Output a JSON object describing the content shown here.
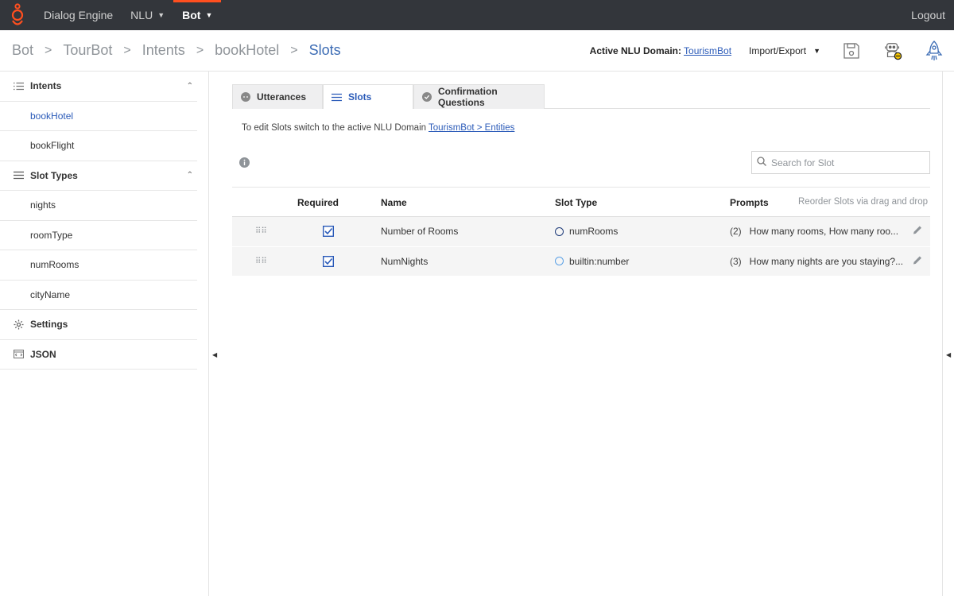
{
  "topbar": {
    "app_name": "Dialog Engine",
    "nav": [
      {
        "label": "NLU",
        "active": false
      },
      {
        "label": "Bot",
        "active": true
      }
    ],
    "logout": "Logout",
    "accent": "#ff4f1f"
  },
  "breadcrumb": [
    "Bot",
    "TourBot",
    "Intents",
    "bookHotel",
    "Slots"
  ],
  "header": {
    "active_domain_label": "Active NLU Domain:",
    "active_domain_value": "TourismBot",
    "import_export": "Import/Export",
    "icons": [
      "save-icon",
      "bot-test-icon",
      "rocket-icon"
    ]
  },
  "sidebar": {
    "intents_label": "Intents",
    "intents": [
      "bookHotel",
      "bookFlight"
    ],
    "selected_intent": "bookHotel",
    "slot_types_label": "Slot Types",
    "slot_types": [
      "nights",
      "roomType",
      "numRooms",
      "cityName"
    ],
    "settings_label": "Settings",
    "json_label": "JSON"
  },
  "tabs": [
    {
      "label": "Utterances",
      "icon": "utterance-icon"
    },
    {
      "label": "Slots",
      "icon": "list-icon"
    },
    {
      "label": "Confirmation Questions",
      "icon": "check-circle-icon"
    }
  ],
  "active_tab": "Slots",
  "edit_note": {
    "text": "To edit Slots switch to the active NLU Domain",
    "link": "TourismBot > Entities"
  },
  "search": {
    "placeholder": "Search for Slot",
    "value": ""
  },
  "table": {
    "columns": {
      "required": "Required",
      "name": "Name",
      "slot_type": "Slot Type",
      "prompts": "Prompts"
    },
    "reorder_hint": "Reorder Slots via drag and drop",
    "rows": [
      {
        "required": true,
        "name": "Number of Rooms",
        "slot_type": "numRooms",
        "type_style": "dark",
        "prompt_count": "(2)",
        "prompt_text": "How many rooms, How many roo..."
      },
      {
        "required": true,
        "name": "NumNights",
        "slot_type": "builtin:number",
        "type_style": "light",
        "prompt_count": "(3)",
        "prompt_text": "How many nights are you staying?..."
      }
    ]
  }
}
